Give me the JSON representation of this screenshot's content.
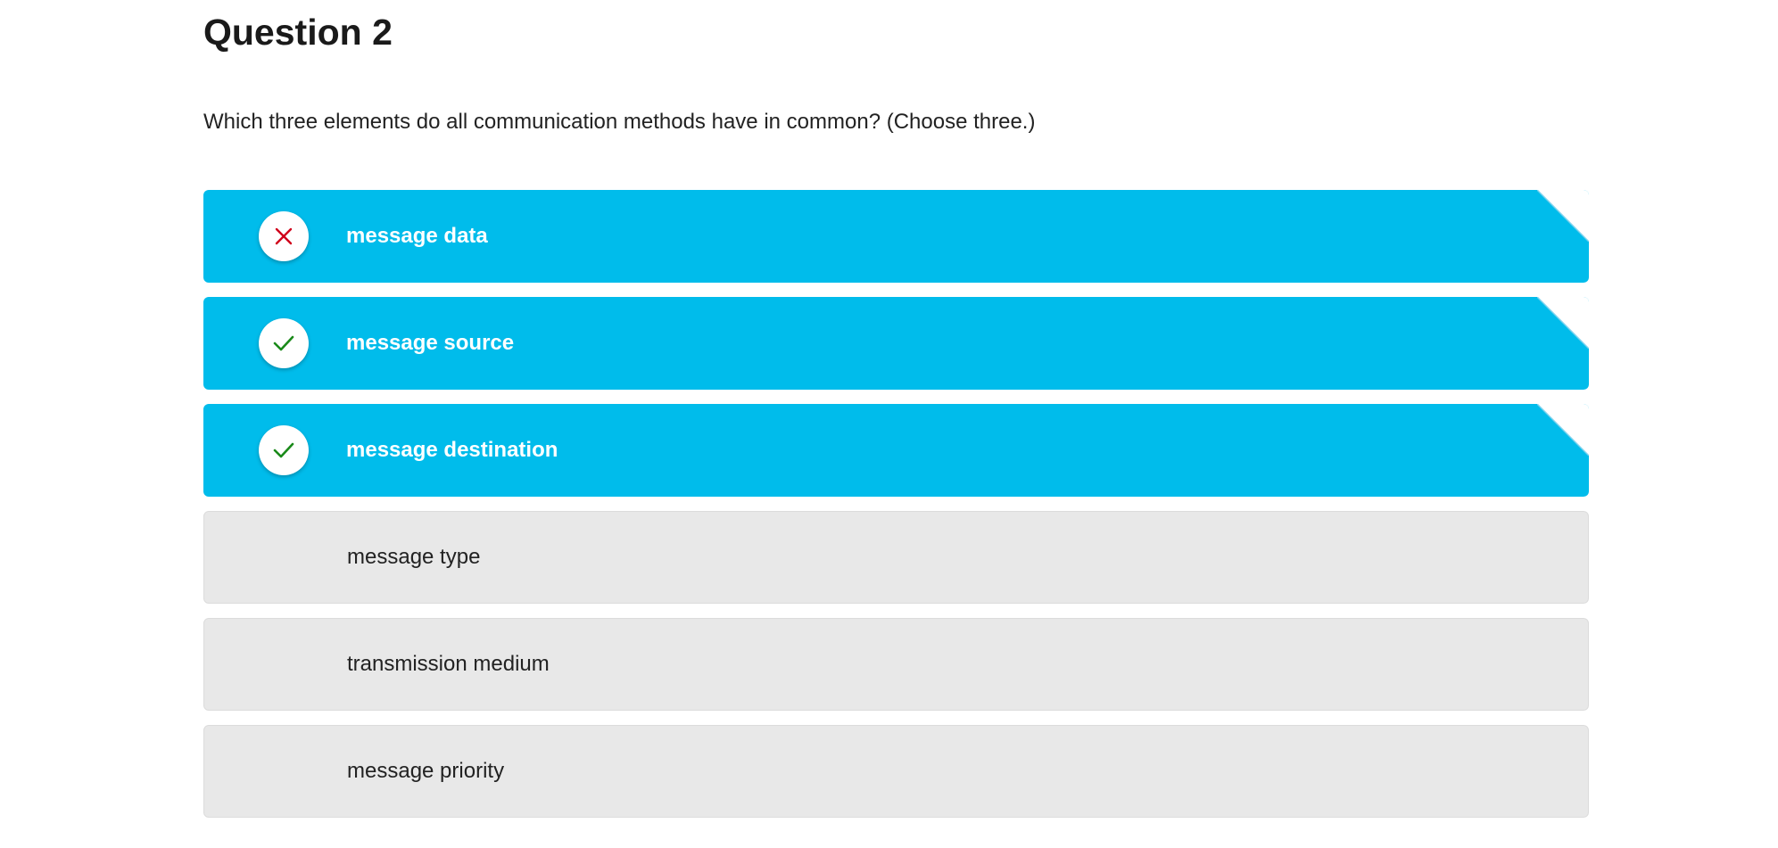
{
  "question": {
    "title": "Question 2",
    "prompt": "Which three elements do all communication methods have in common? (Choose three.)"
  },
  "colors": {
    "selected_bg": "#00bceb",
    "unselected_bg": "#e8e8e8",
    "correct": "#1a8a1a",
    "incorrect": "#d0021b"
  },
  "options": [
    {
      "label": "message data",
      "selected": true,
      "result": "incorrect",
      "icon": "x-icon"
    },
    {
      "label": "message source",
      "selected": true,
      "result": "correct",
      "icon": "check-icon"
    },
    {
      "label": "message destination",
      "selected": true,
      "result": "correct",
      "icon": "check-icon"
    },
    {
      "label": "message type",
      "selected": false
    },
    {
      "label": "transmission medium",
      "selected": false
    },
    {
      "label": "message priority",
      "selected": false
    }
  ]
}
